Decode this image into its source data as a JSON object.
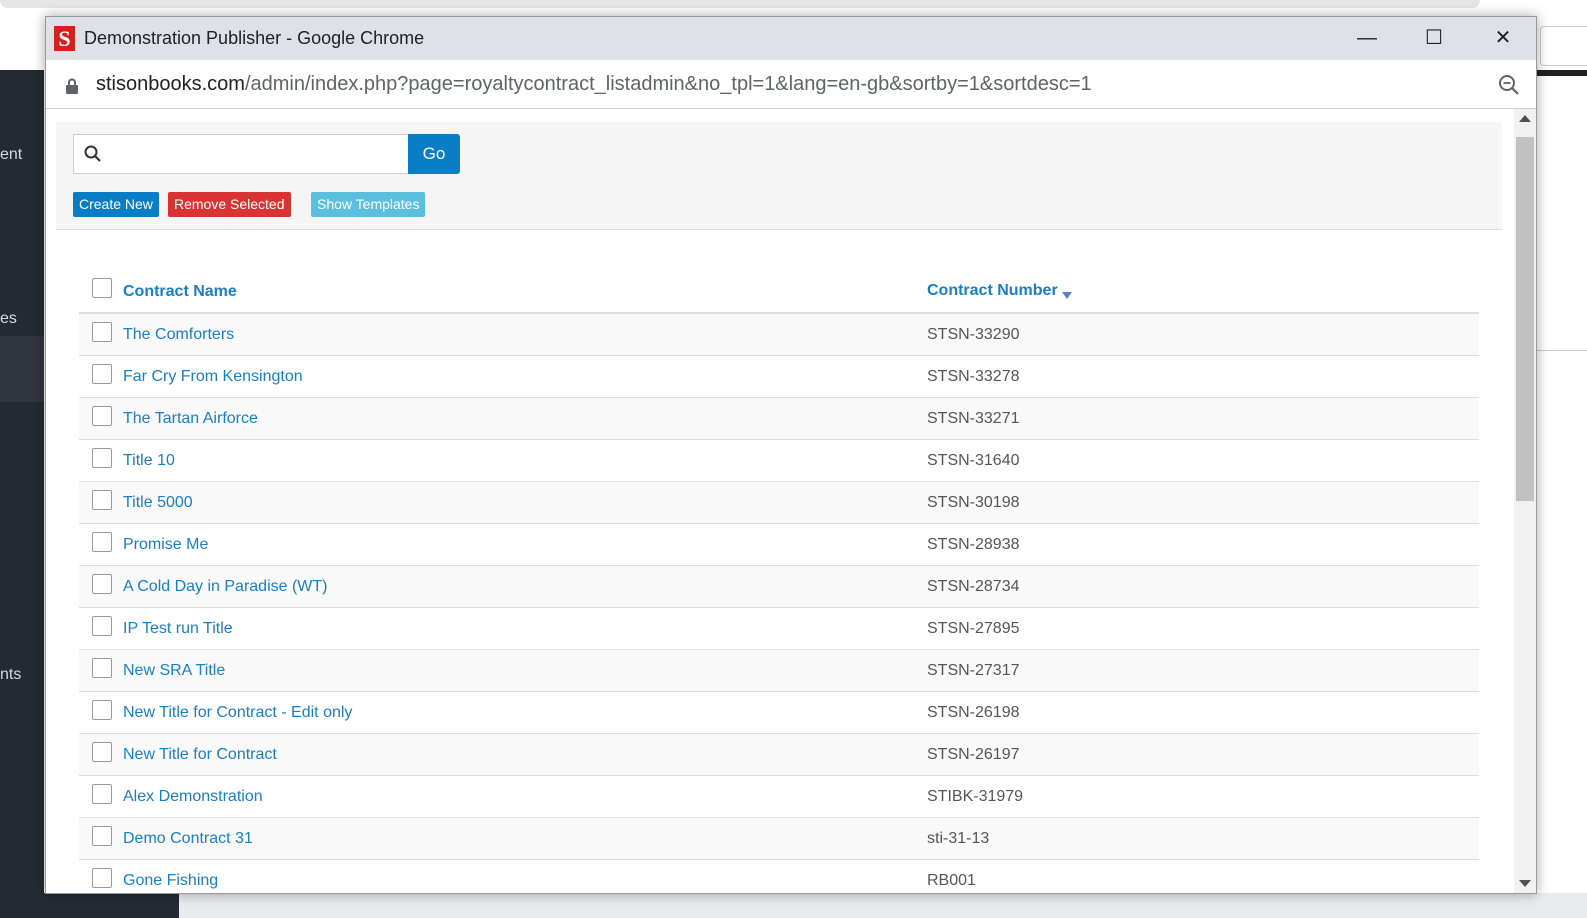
{
  "window": {
    "title": "Demonstration Publisher - Google Chrome",
    "minimize_symbol": "—",
    "maximize_symbol": "☐",
    "close_symbol": "✕"
  },
  "address": {
    "host": "stisonbooks.com",
    "path": "/admin/index.php?page=royaltycontract_listadmin&no_tpl=1&lang=en-gb&sortby=1&sortdesc=1"
  },
  "background": {
    "sidebar_labels": [
      "ent",
      "es",
      "nts"
    ]
  },
  "toolbar": {
    "search_value": "",
    "search_placeholder": "",
    "go_label": "Go",
    "create_label": "Create New",
    "remove_label": "Remove Selected",
    "templates_label": "Show Templates"
  },
  "table": {
    "columns": [
      "Contract Name",
      "Contract Number"
    ],
    "sorted_column": "Contract Number",
    "sort_direction": "descending",
    "rows": [
      {
        "name": "The Comforters",
        "number": "STSN-33290"
      },
      {
        "name": "Far Cry From Kensington",
        "number": "STSN-33278"
      },
      {
        "name": "The Tartan Airforce",
        "number": "STSN-33271"
      },
      {
        "name": "Title 10",
        "number": "STSN-31640"
      },
      {
        "name": "Title 5000",
        "number": "STSN-30198"
      },
      {
        "name": "Promise Me",
        "number": "STSN-28938"
      },
      {
        "name": "A Cold Day in Paradise (WT)",
        "number": "STSN-28734"
      },
      {
        "name": "IP Test run Title",
        "number": "STSN-27895"
      },
      {
        "name": "New SRA Title",
        "number": "STSN-27317"
      },
      {
        "name": "New Title for Contract - Edit only",
        "number": "STSN-26198"
      },
      {
        "name": "New Title for Contract",
        "number": "STSN-26197"
      },
      {
        "name": "Alex Demonstration",
        "number": "STIBK-31979"
      },
      {
        "name": "Demo Contract 31",
        "number": "sti-31-13"
      },
      {
        "name": "Gone Fishing",
        "number": "RB001"
      }
    ]
  },
  "colors": {
    "link": "#1a7ec4",
    "primary_button": "#0a7dc7",
    "danger_button": "#d93333",
    "info_button": "#5bc0de"
  }
}
